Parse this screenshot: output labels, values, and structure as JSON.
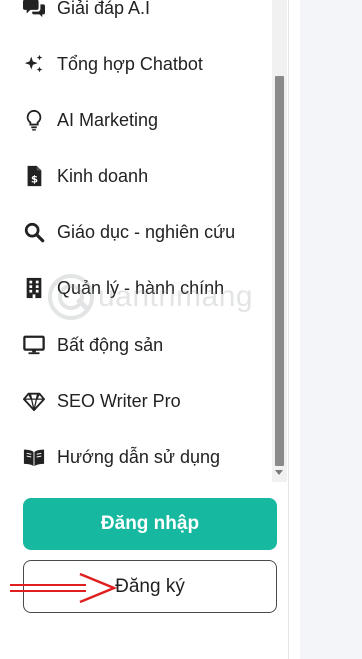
{
  "menu": {
    "items": [
      {
        "label": "Giải đáp A.I",
        "icon": "chat-bubbles-icon"
      },
      {
        "label": "Tổng hợp Chatbot",
        "icon": "sparkles-icon"
      },
      {
        "label": "AI Marketing",
        "icon": "lightbulb-icon"
      },
      {
        "label": "Kinh doanh",
        "icon": "dollar-document-icon"
      },
      {
        "label": "Giáo dục - nghiên cứu",
        "icon": "magnifier-icon"
      },
      {
        "label": "Quản lý - hành chính",
        "icon": "building-icon"
      },
      {
        "label": "Bất động sản",
        "icon": "monitor-icon"
      },
      {
        "label": "SEO Writer Pro",
        "icon": "diamond-icon"
      },
      {
        "label": "Hướng dẫn sử dụng",
        "icon": "open-book-icon"
      }
    ]
  },
  "auth": {
    "login_label": "Đăng nhập",
    "register_label": "Đăng ký"
  },
  "watermark": {
    "text": "uantrimang"
  },
  "colors": {
    "login_button": "#16b8a0",
    "annotation_arrow": "#e02020",
    "right_pane": "#f4f5f9"
  }
}
